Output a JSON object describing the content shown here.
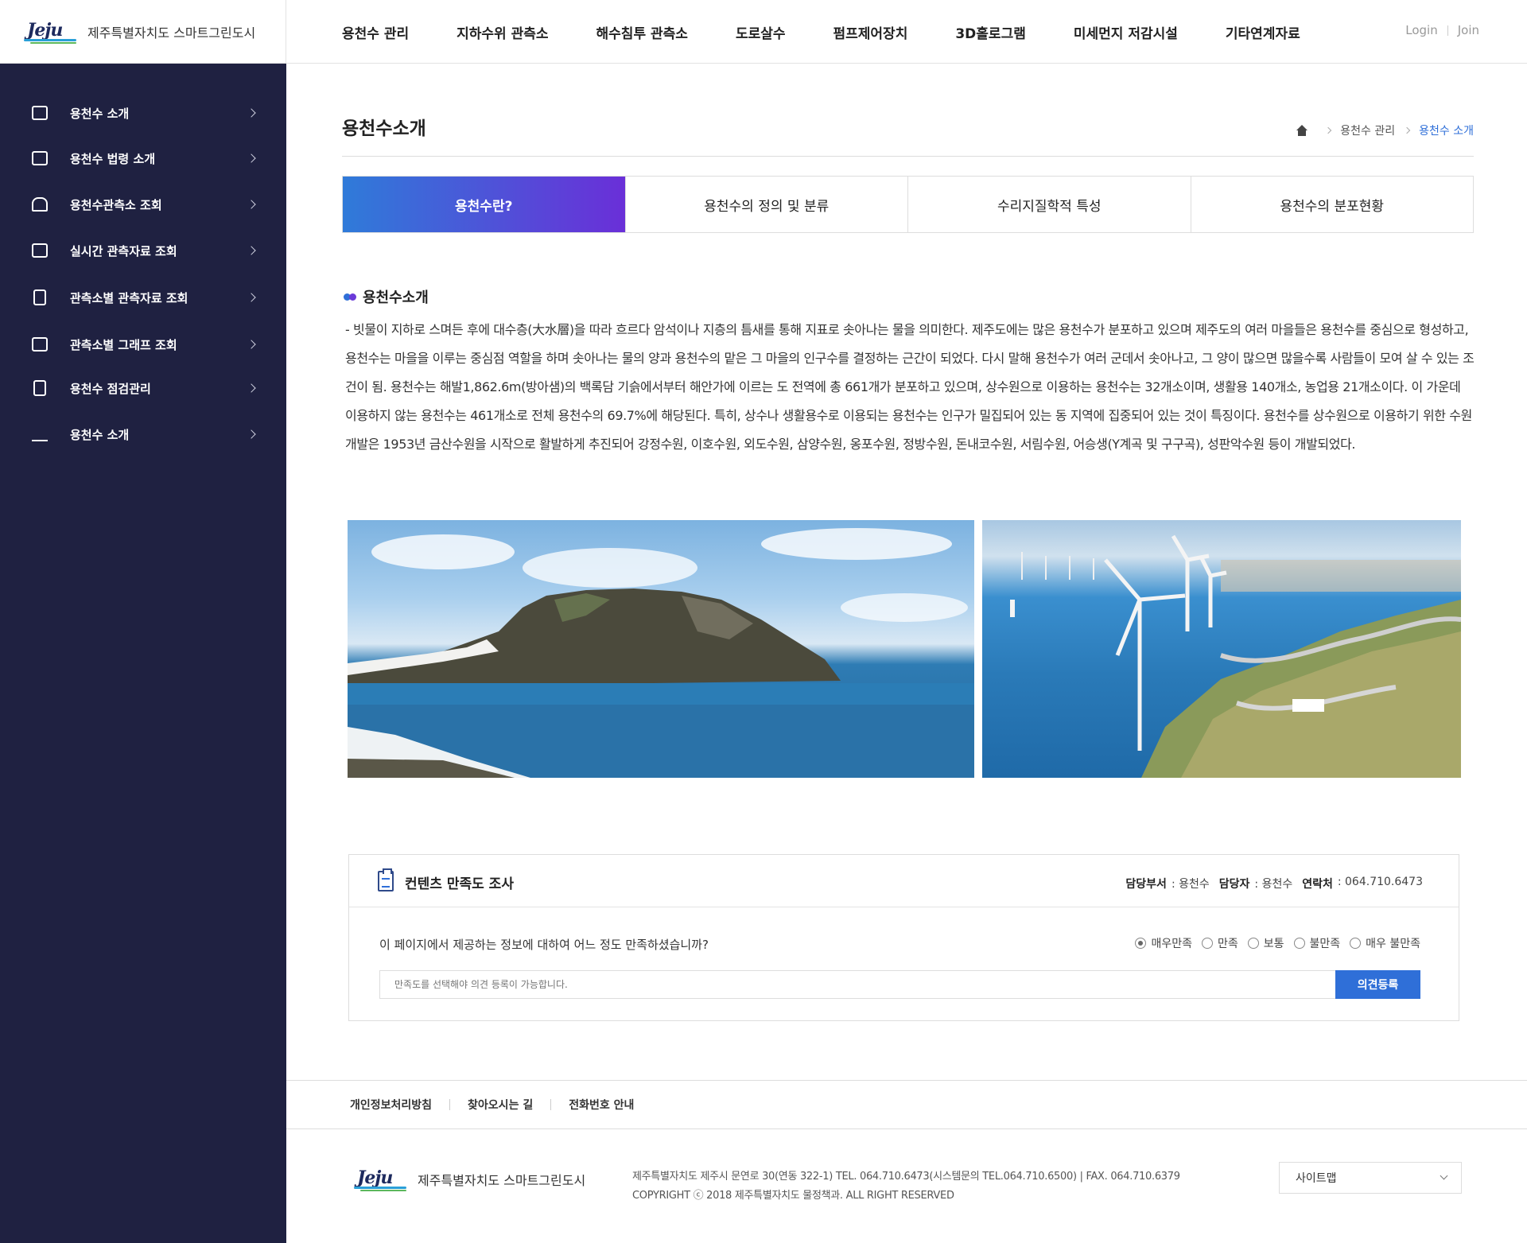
{
  "header": {
    "logo_wordmark": "Jeju",
    "site_name": "제주특별자치도 스마트그린도시",
    "nav": [
      "용천수 관리",
      "지하수위 관측소",
      "해수침투 관측소",
      "도로살수",
      "펌프제어장치",
      "3D홀로그램",
      "미세먼지 저감시설",
      "기타연계자료"
    ],
    "login": "Login",
    "join": "Join"
  },
  "sidebar": {
    "items": [
      {
        "label": "용천수 소개",
        "icon": "monitor-icon"
      },
      {
        "label": "용천수 법령 소개",
        "icon": "book-icon"
      },
      {
        "label": "용천수관측소 조회",
        "icon": "station-icon"
      },
      {
        "label": "실시간 관측자료 조회",
        "icon": "screen-icon"
      },
      {
        "label": "관측소별 관측자료 조회",
        "icon": "clipboard-icon"
      },
      {
        "label": "관측소별 그래프 조회",
        "icon": "chart-board-icon"
      },
      {
        "label": "용천수 점검관리",
        "icon": "document-icon"
      },
      {
        "label": "용천수 소개",
        "icon": "bar-chart-icon"
      }
    ]
  },
  "page": {
    "title": "용천수소개",
    "breadcrumb": [
      "용천수 관리",
      "용천수 소개"
    ]
  },
  "tabs": [
    "용천수란?",
    "용천수의 정의 및 분류",
    "수리지질학적 특성",
    "용천수의 분포현황"
  ],
  "section": {
    "title": "용천수소개",
    "body": "- 빗물이 지하로 스며든 후에 대수층(大水層)을 따라 흐르다 암석이나 지층의 틈새를 통해 지표로 솟아나는 물을 의미한다. 제주도에는 많은 용천수가 분포하고 있으며 제주도의 여러 마을들은 용천수를 중심으로 형성하고, 용천수는 마을을 이루는 중심점 역할을 하며 솟아나는 물의 양과 용천수의 맡은 그 마을의 인구수를 결정하는 근간이 되었다. 다시 말해 용천수가 여러 군데서 솟아나고, 그 양이 많으면 많을수록 사람들이 모여 살 수 있는 조건이 됨. 용천수는 해발1,862.6m(방아샘)의 백록담 기슭에서부터 해안가에 이르는 도 전역에 총 661개가 분포하고 있으며, 상수원으로 이용하는 용천수는 32개소이며, 생활용 140개소, 농업용 21개소이다. 이 가운데 이용하지 않는 용천수는 461개소로 전체 용천수의 69.7%에 해당된다. 특히, 상수나 생활용수로 이용되는 용천수는 인구가 밀집되어 있는 동 지역에 집중되어 있는 것이 특징이다. 용천수를 상수원으로 이용하기 위한 수원개발은 1953년 금산수원을 시작으로 활발하게 추진되어 강정수원, 이호수원, 외도수원, 삼양수원, 옹포수원, 정방수원, 돈내코수원, 서림수원, 어승생(Y계곡 및 구구곡), 성판악수원 등이 개발되었다."
  },
  "survey": {
    "title": "컨텐츠 만족도 조사",
    "dept_label": "담당부서",
    "dept_value": ": 용천수",
    "manager_label": "담당자",
    "manager_value": ": 용천수",
    "contact_label": "연락처",
    "contact_value": ": 064.710.6473",
    "question": "이 페이지에서 제공하는 정보에 대하여 어느 정도 만족하셨습니까?",
    "options": [
      "매우만족",
      "만족",
      "보통",
      "불만족",
      "매우 불만족"
    ],
    "selected": "매우만족",
    "input_placeholder": "만족도를 선택해야 의견 등록이 가능합니다.",
    "submit_label": "의견등록"
  },
  "footer": {
    "links": [
      "개인정보처리방침",
      "찾아오시는 길",
      "전화번호 안내"
    ],
    "site_name": "제주특별자치도 스마트그린도시",
    "address": "제주특별자치도 제주시 문연로 30(연동 322-1) TEL. 064.710.6473(시스템문의 TEL.064.710.6500) | FAX. 064.710.6379",
    "copyright": "COPYRIGHT ⓒ 2018 제주특별자치도 물정책과. ALL RIGHT RESERVED",
    "sitemap_label": "사이트맵"
  }
}
